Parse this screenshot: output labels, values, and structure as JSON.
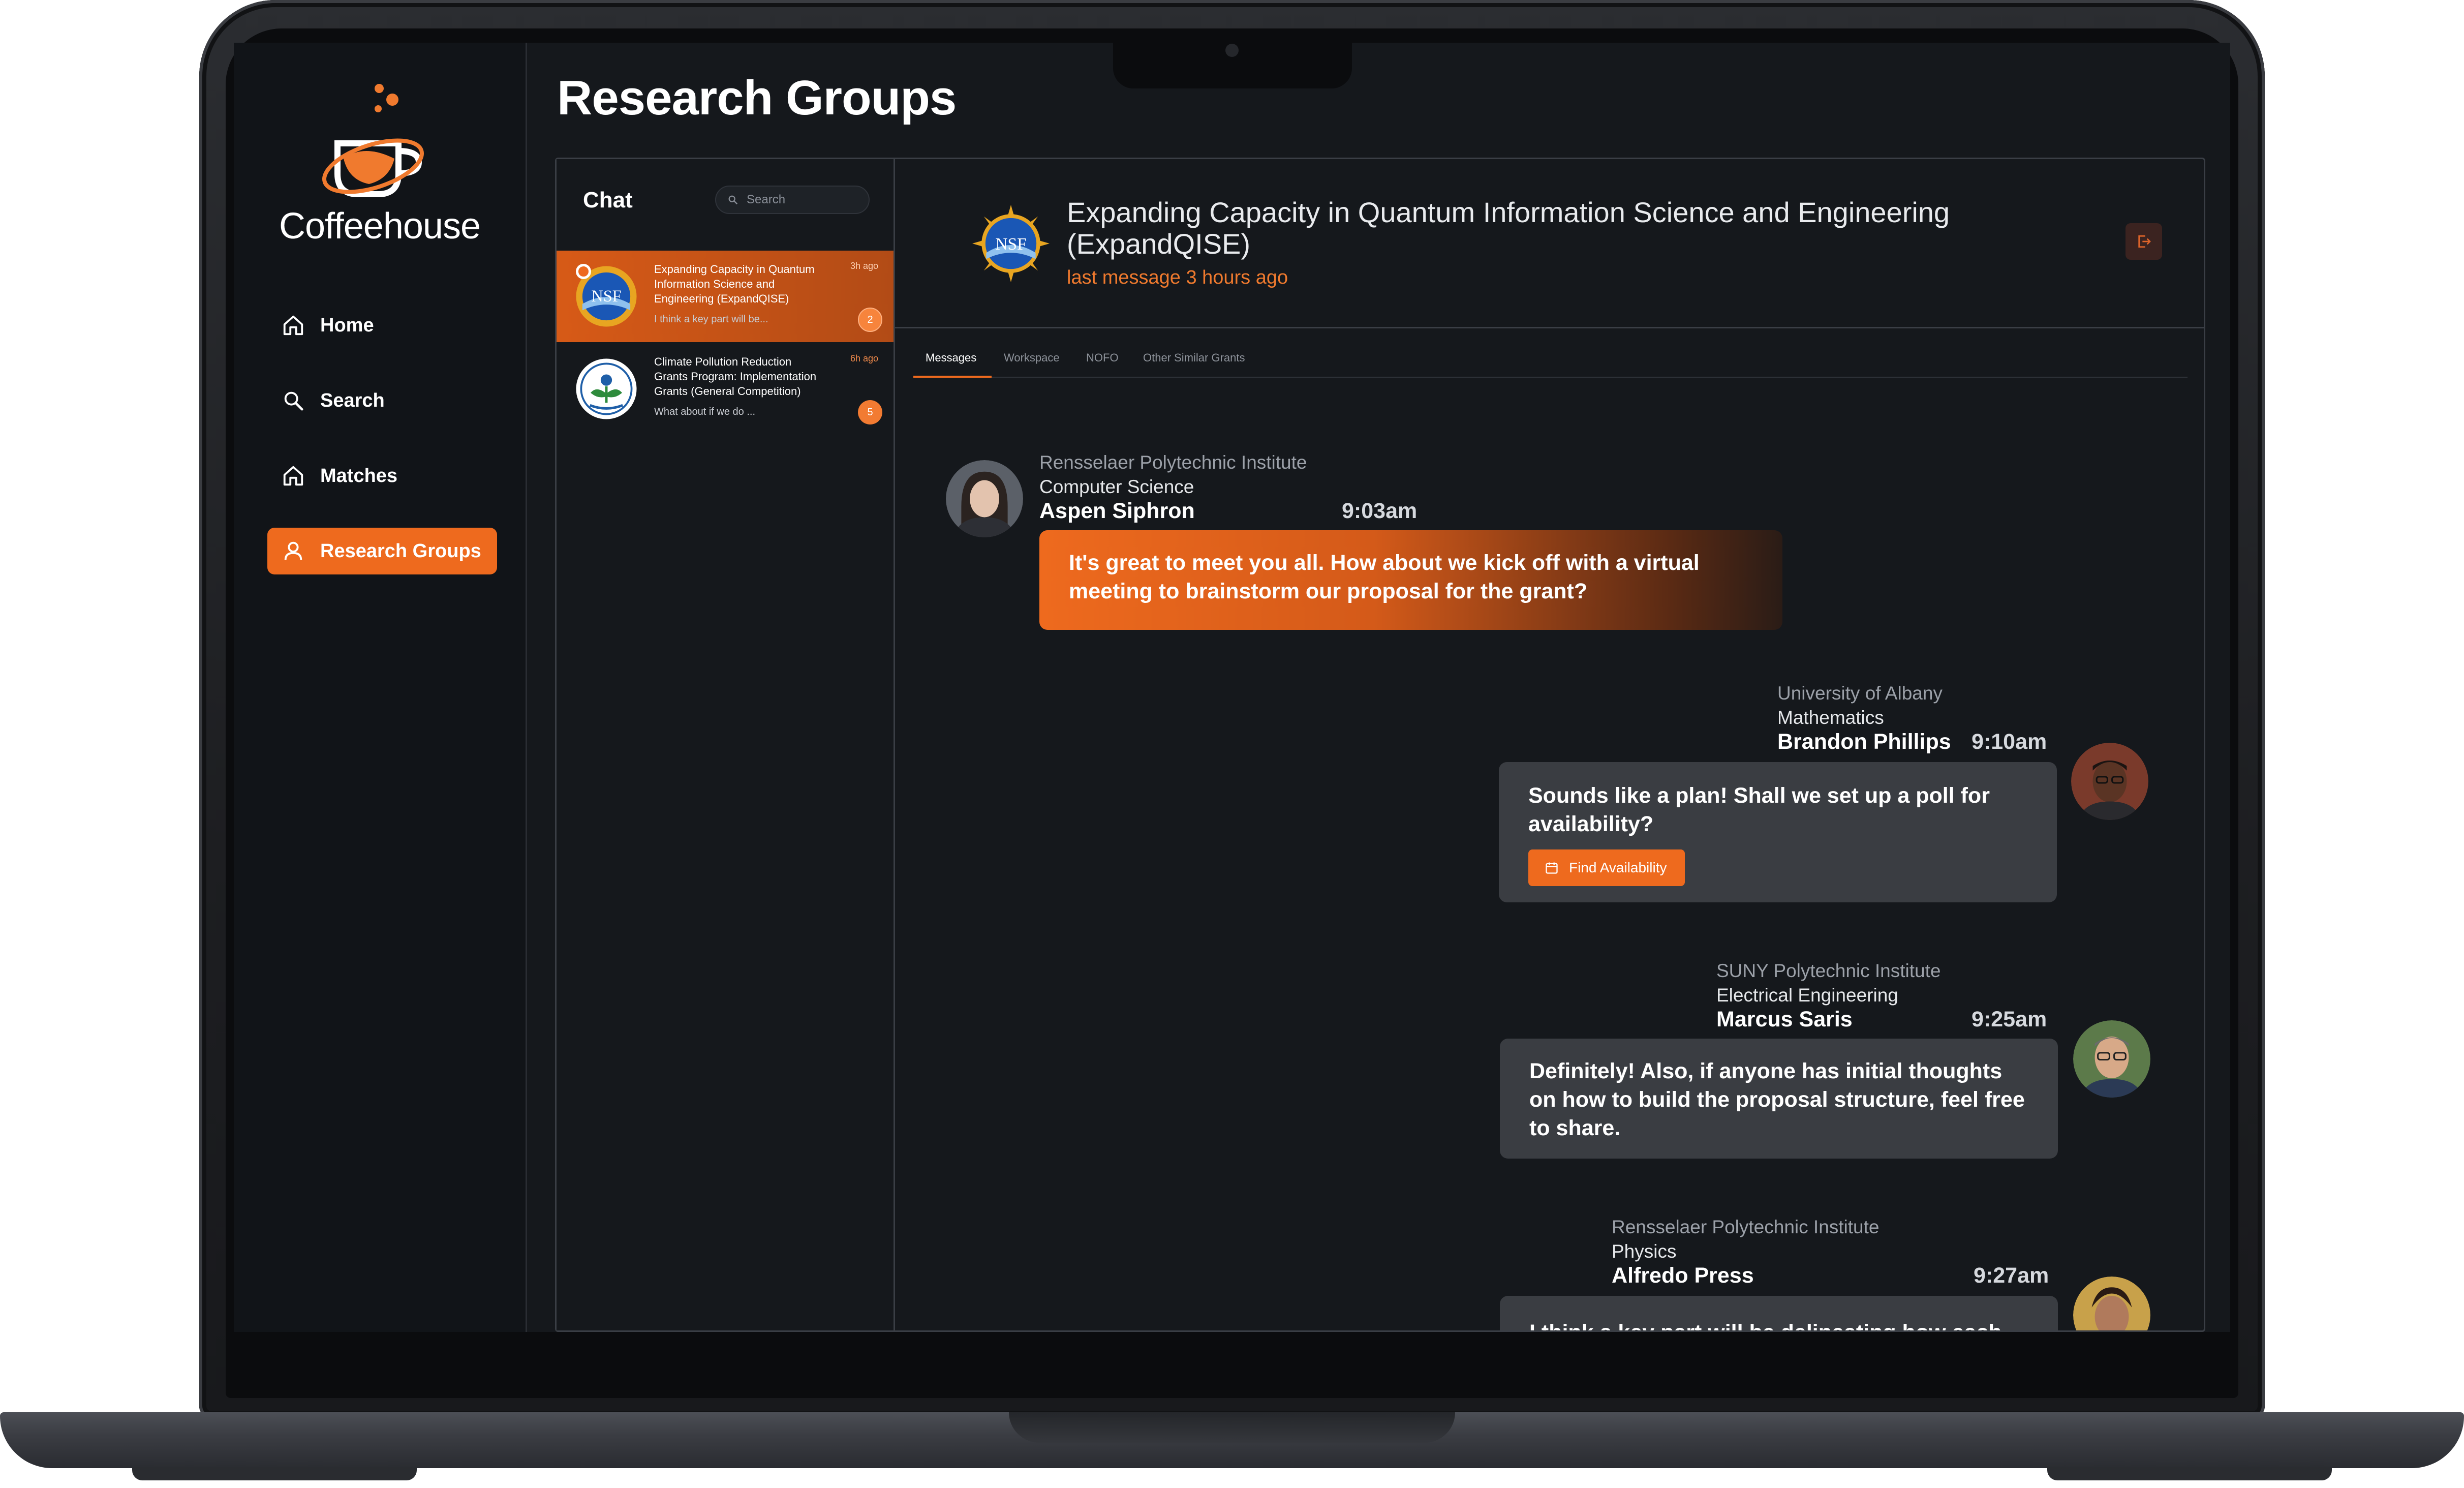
{
  "app": {
    "brand": "Coffeehouse",
    "accent_color": "#ee6a1e",
    "page_title": "Research Groups"
  },
  "nav": [
    {
      "label": "Home",
      "icon": "home-icon",
      "active": false
    },
    {
      "label": "Search",
      "icon": "search-icon",
      "active": false
    },
    {
      "label": "Matches",
      "icon": "home-icon",
      "active": false
    },
    {
      "label": "Research Groups",
      "icon": "user-icon",
      "active": true
    }
  ],
  "chat_list": {
    "title": "Chat",
    "search_placeholder": "Search",
    "items": [
      {
        "title": "Expanding Capacity in Quantum Information Science and Engineering (ExpandQISE)",
        "time": "3h ago",
        "preview": "I think a key part will be...",
        "unread": "2",
        "logo": "nsf-logo",
        "active": true
      },
      {
        "title": "Climate Pollution Reduction Grants Program: Implementation Grants (General Competition)",
        "time": "6h ago",
        "preview": "What about if we do ...",
        "unread": "5",
        "logo": "epa-logo",
        "active": false
      }
    ]
  },
  "conversation": {
    "title": "Expanding Capacity in Quantum Information Science and Engineering (ExpandQISE)",
    "subtitle": "last message 3 hours ago",
    "logo": "nsf-logo",
    "tabs": [
      "Messages",
      "Workspace",
      "NOFO",
      "Other Similar Grants"
    ],
    "active_tab": "Messages",
    "messages": [
      {
        "org": "Rensselaer Polytechnic Institute",
        "dept": "Computer Science",
        "name": "Aspen Siphron",
        "time": "9:03am",
        "text": "It's great to meet you all. How about we kick off with a virtual meeting to brainstorm our proposal for the grant?",
        "own": true
      },
      {
        "org": "University of Albany",
        "dept": "Mathematics",
        "name": "Brandon Phillips",
        "time": "9:10am",
        "text": "Sounds like a plan! Shall we set up a poll for availability?",
        "action_label": "Find Availability",
        "own": false
      },
      {
        "org": "SUNY Polytechnic Institute",
        "dept": "Electrical Engineering",
        "name": "Marcus Saris",
        "time": "9:25am",
        "text": "Definitely! Also, if anyone has initial thoughts on how to build the proposal structure, feel free to share.",
        "own": false
      },
      {
        "org": "Rensselaer Polytechnic Institute",
        "dept": "Physics",
        "name": "Alfredo Press",
        "time": "9:27am",
        "text": "I think a key part will be delineating how each",
        "own": false
      }
    ]
  }
}
